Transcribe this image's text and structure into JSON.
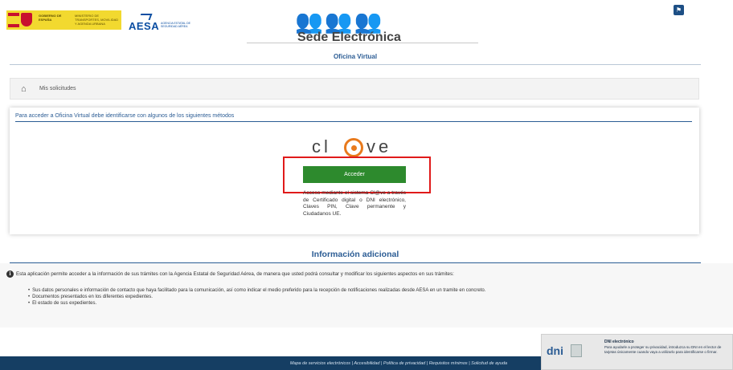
{
  "header": {
    "gov_logo_text": "GOBIERNO DE ESPAÑA",
    "ministry_text": "MINISTERIO DE TRANSPORTES, MOVILIDAD Y AGENDA URBANA",
    "aesa_name": "AESA",
    "aesa_sub": "AGENCIA ESTATAL DE SEGURIDAD AÉREA",
    "portal_title": "Sede Electrónica",
    "language_icon": "flag-icon"
  },
  "oficina_title": "Oficina Virtual",
  "breadcrumb": {
    "home_icon": "home-icon",
    "current": "Mis solicitudes"
  },
  "login": {
    "heading": "Para acceder a Oficina Virtual debe identificarse con algunos de los siguientes métodos",
    "clave_prefix": "cl",
    "clave_suffix": "ve",
    "button_label": "Acceder",
    "description": "Acceso mediante el sistema Cl@ve a través de Certificado digital o DNI electrónico, Claves PIN, Clave permanente y Ciudadanos UE."
  },
  "info": {
    "title": "Información adicional",
    "intro": "Esta aplicación permite acceder a la información de sus trámites con la Agencia Estatal de Seguridad Aérea, de manera que usted podrá consultar y modificar los siguientes aspectos en sus trámites:",
    "items": [
      "Sus datos personales e información de contacto que haya facilitado para la comunicación, así como indicar el medio preferido para la recepción de notificaciones realizadas desde AESA en un tramite en concreto.",
      "Documentos presentados en los diferentes expedientes.",
      "El estado de sus expedientes."
    ]
  },
  "footer": {
    "links": "Mapa de servicios electrónicos | Accesibilidad | Política de privacidad | Requisitos mínimos | Solicitud de ayuda"
  },
  "dni_popup": {
    "logo_text": "dni",
    "title": "DNI electrónico",
    "text": "Para ayudarle a proteger su privacidad, introduzca su DNI en el lector de tarjetas únicamente cuando vaya a utilizarlo para identificarse o firmar."
  },
  "colors": {
    "accent_blue": "#2b5c94",
    "button_green": "#2d8a2d",
    "focus_red": "#e01a1a",
    "footer_navy": "#153e63"
  }
}
